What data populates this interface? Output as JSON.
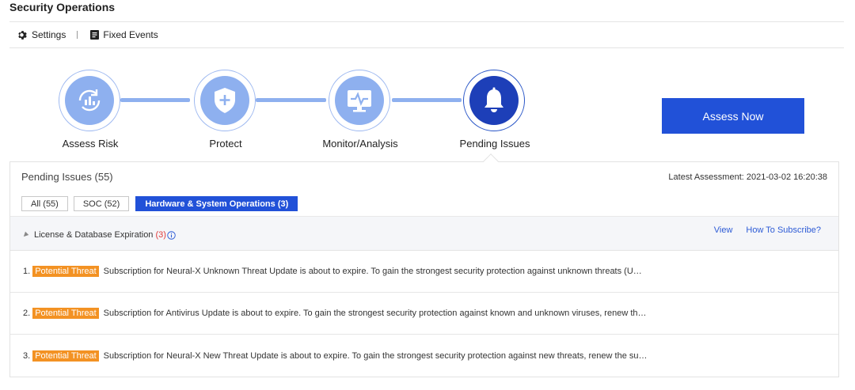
{
  "page": {
    "title": "Security Operations"
  },
  "toolbar": {
    "settings_label": "Settings",
    "fixed_events_label": "Fixed Events"
  },
  "steps": [
    {
      "label": "Assess Risk",
      "icon": "chart-cycle-icon"
    },
    {
      "label": "Protect",
      "icon": "shield-plus-icon"
    },
    {
      "label": "Monitor/Analysis",
      "icon": "monitor-pulse-icon"
    },
    {
      "label": "Pending Issues",
      "icon": "bell-icon",
      "active": true
    }
  ],
  "assess_button": {
    "label": "Assess Now"
  },
  "panel": {
    "title": "Pending Issues (55)",
    "latest_assessment": "Latest Assessment: 2021-03-02 16:20:38",
    "tabs": [
      {
        "label": "All (55)"
      },
      {
        "label": "SOC (52)"
      },
      {
        "label": "Hardware & System Operations (3)",
        "active": true
      }
    ],
    "group": {
      "title": "License & Database Expiration",
      "count": "(3)",
      "view_label": "View",
      "subscribe_label": "How To Subscribe?"
    },
    "items": [
      {
        "num": "1.",
        "badge": "Potential Threat",
        "text": "Subscription for Neural-X Unknown Threat Update is about to expire. To gain the strongest security protection against unknown threats (U…"
      },
      {
        "num": "2.",
        "badge": "Potential Threat",
        "text": "Subscription for Antivirus Update is about to expire. To gain the strongest security protection against known and unknown viruses, renew th…"
      },
      {
        "num": "3.",
        "badge": "Potential Threat",
        "text": "Subscription for Neural-X New Threat Update is about to expire. To gain the strongest security protection against new threats, renew the su…"
      }
    ]
  },
  "colors": {
    "accent": "#2151d8",
    "step_fill": "#8eb0ef",
    "step_active": "#1d3fb8",
    "badge": "#f39223",
    "link": "#2d5bd6",
    "count_red": "#e03c3c"
  }
}
